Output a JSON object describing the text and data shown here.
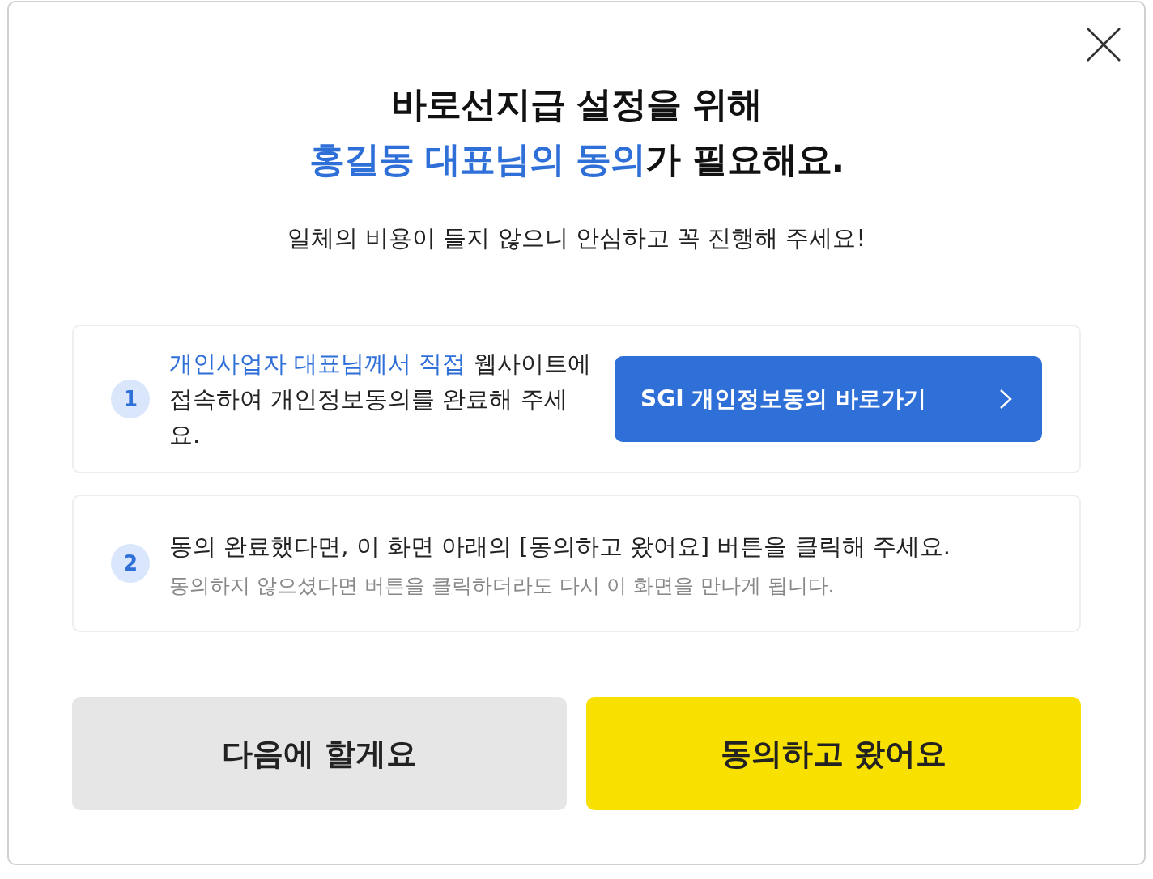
{
  "dialog": {
    "title_line_1": "바로선지급 설정을 위해",
    "title_highlight": "홍길동 대표님의 동의",
    "title_rest": "가 필요해요.",
    "subtitle": "일체의 비용이 들지 않으니 안심하고 꼭 진행해 주세요!"
  },
  "steps": [
    {
      "kind": "link",
      "number": "1",
      "highlight": "개인사업자 대표님께서 직접",
      "text": " 웹사이트에\n접속하여 개인정보동의를 완료해 주세요.",
      "button": "SGI 개인정보동의 바로가기"
    },
    {
      "kind": "note",
      "number": "2",
      "text": "동의 완료했다면, 이 화면 아래의 [동의하고 왔어요] 버튼을 클릭해 주세요.",
      "note": "동의하지 않으셨다면 버튼을 클릭하더라도 다시 이 화면을 만나게 됩니다."
    }
  ],
  "buttons": [
    {
      "kind": "secondary",
      "label": "다음에 할게요"
    },
    {
      "kind": "primary",
      "label": "동의하고 왔어요"
    }
  ]
}
